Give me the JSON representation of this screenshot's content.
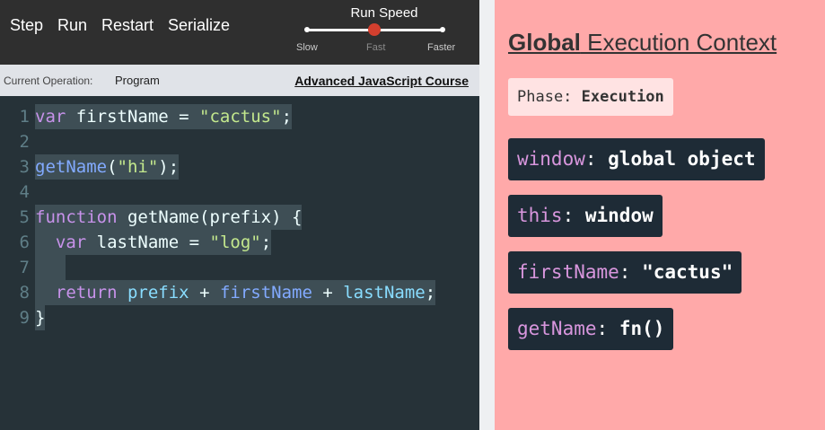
{
  "toolbar": {
    "step_label": "Step",
    "run_label": "Run",
    "restart_label": "Restart",
    "serialize_label": "Serialize",
    "speed_title": "Run Speed",
    "speed_slow": "Slow",
    "speed_fast": "Fast",
    "speed_faster": "Faster",
    "speed_selected": "Fast"
  },
  "operation": {
    "label": "Current Operation:",
    "value": "Program",
    "course_link": "Advanced JavaScript Course"
  },
  "code": [
    {
      "n": "1",
      "parts": [
        {
          "t": "var",
          "c": "kw"
        },
        {
          "t": " firstName = ",
          "c": ""
        },
        {
          "t": "\"cactus\"",
          "c": "str"
        },
        {
          "t": ";",
          "c": ""
        }
      ],
      "hl": true
    },
    {
      "n": "2",
      "parts": [],
      "hl": false
    },
    {
      "n": "3",
      "parts": [
        {
          "t": "getName",
          "c": "fn"
        },
        {
          "t": "(",
          "c": ""
        },
        {
          "t": "\"hi\"",
          "c": "str"
        },
        {
          "t": ");",
          "c": ""
        }
      ],
      "hl": true
    },
    {
      "n": "4",
      "parts": [],
      "hl": false
    },
    {
      "n": "5",
      "parts": [
        {
          "t": "function",
          "c": "kw"
        },
        {
          "t": " getName(prefix) {",
          "c": ""
        }
      ],
      "hl": true
    },
    {
      "n": "6",
      "parts": [
        {
          "t": "  ",
          "c": ""
        },
        {
          "t": "var",
          "c": "kw"
        },
        {
          "t": " lastName = ",
          "c": ""
        },
        {
          "t": "\"log\"",
          "c": "str"
        },
        {
          "t": ";",
          "c": ""
        }
      ],
      "hl": true
    },
    {
      "n": "7",
      "parts": [
        {
          "t": "   ",
          "c": ""
        }
      ],
      "hl": true
    },
    {
      "n": "8",
      "parts": [
        {
          "t": "  ",
          "c": ""
        },
        {
          "t": "return",
          "c": "kw"
        },
        {
          "t": " ",
          "c": ""
        },
        {
          "t": "prefix",
          "c": "var"
        },
        {
          "t": " + ",
          "c": ""
        },
        {
          "t": "firstName",
          "c": "fn"
        },
        {
          "t": " + ",
          "c": ""
        },
        {
          "t": "lastName",
          "c": "var"
        },
        {
          "t": ";",
          "c": ""
        }
      ],
      "hl": true
    },
    {
      "n": "9",
      "parts": [
        {
          "t": "}",
          "c": ""
        }
      ],
      "hl": true
    }
  ],
  "context": {
    "title_bold": "Global",
    "title_rest": " Execution Context",
    "phase_label": "Phase: ",
    "phase_value": "Execution",
    "variables": [
      {
        "name": "window",
        "value": "global object"
      },
      {
        "name": "this",
        "value": "window"
      },
      {
        "name": "firstName",
        "value": "\"cactus\""
      },
      {
        "name": "getName",
        "value": "fn()"
      }
    ]
  },
  "colors": {
    "editor_bg": "#263238",
    "toolbar_bg": "#2f2f2f",
    "context_bg": "#ffa9a9",
    "card_bg": "#1e2b36",
    "speed_knob": "#d23f2e",
    "keyword": "#c792ea",
    "string": "#c3e88d",
    "function": "#82aaff"
  }
}
